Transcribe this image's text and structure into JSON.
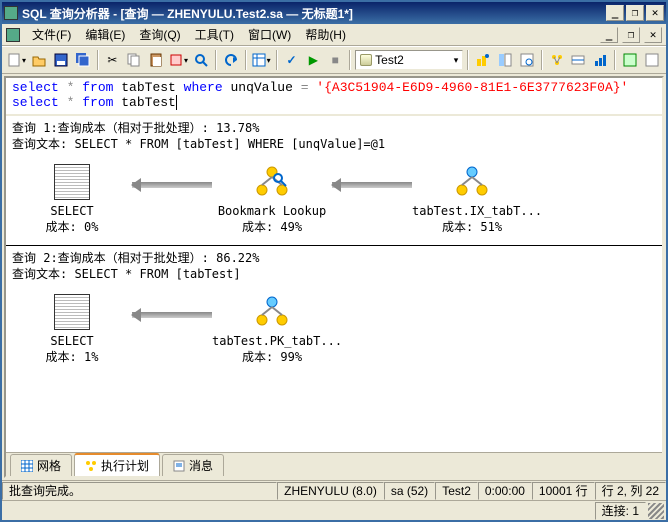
{
  "title": "SQL 查询分析器 - [查询 — ZHENYULU.Test2.sa — 无标题1*]",
  "menus": {
    "file": "文件(F)",
    "edit": "编辑(E)",
    "query": "查询(Q)",
    "tools": "工具(T)",
    "window": "窗口(W)",
    "help": "帮助(H)"
  },
  "db_selector": "Test2",
  "sql": {
    "line1_kw1": "select",
    "line1_star": " * ",
    "line1_kw2": "from",
    "line1_tab": " tabTest ",
    "line1_kw3": "where",
    "line1_col": " unqValue ",
    "line1_eq": "=",
    "line1_str": " '{A3C51904-E6D9-4960-81E1-6E3777623F0A}'",
    "line2_kw1": "select",
    "line2_star": " * ",
    "line2_kw2": "from",
    "line2_tab": " tabTest"
  },
  "plan1": {
    "header1": "查询 1:查询成本（相对于批处理）: 13.78%",
    "header2": "查询文本: SELECT * FROM [tabTest] WHERE [unqValue]=@1",
    "n1_label": "SELECT",
    "n1_cost": "成本: 0%",
    "n2_label": "Bookmark Lookup",
    "n2_cost": "成本: 49%",
    "n3_label": "tabTest.IX_tabT...",
    "n3_cost": "成本: 51%"
  },
  "plan2": {
    "header1": "查询 2:查询成本（相对于批处理）: 86.22%",
    "header2": "查询文本: SELECT * FROM [tabTest]",
    "n1_label": "SELECT",
    "n1_cost": "成本: 1%",
    "n2_label": "tabTest.PK_tabT...",
    "n2_cost": "成本: 99%"
  },
  "tabs": {
    "grid": "网格",
    "plan": "执行计划",
    "msg": "消息"
  },
  "status": {
    "main": "批查询完成。",
    "server": "ZHENYULU (8.0)",
    "user": "sa (52)",
    "db": "Test2",
    "time": "0:00:00",
    "rows": "10001 行",
    "pos": "行 2, 列 22",
    "conn": "连接: 1"
  },
  "chart_data": [
    {
      "type": "table",
      "title": "Query 1 Execution Plan (13.78% of batch)",
      "series": [
        {
          "name": "SELECT",
          "values": [
            0
          ]
        },
        {
          "name": "Bookmark Lookup",
          "values": [
            49
          ]
        },
        {
          "name": "tabTest.IX_tabT...",
          "values": [
            51
          ]
        }
      ],
      "ylabel": "Cost %"
    },
    {
      "type": "table",
      "title": "Query 2 Execution Plan (86.22% of batch)",
      "series": [
        {
          "name": "SELECT",
          "values": [
            1
          ]
        },
        {
          "name": "tabTest.PK_tabT...",
          "values": [
            99
          ]
        }
      ],
      "ylabel": "Cost %"
    }
  ]
}
